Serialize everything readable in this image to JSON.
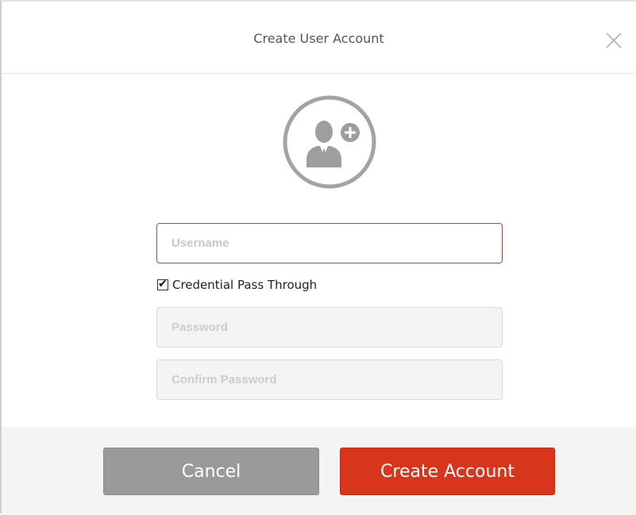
{
  "dialog": {
    "title": "Create User Account",
    "close_icon": "close-icon",
    "avatar_icon": "add-user-icon"
  },
  "form": {
    "username": {
      "value": "",
      "placeholder": "Username"
    },
    "credential_pass_through": {
      "label": "Credential Pass Through",
      "checked": true
    },
    "password": {
      "value": "",
      "placeholder": "Password"
    },
    "confirm_password": {
      "value": "",
      "placeholder": "Confirm Password"
    }
  },
  "actions": {
    "cancel_label": "Cancel",
    "create_label": "Create Account"
  },
  "colors": {
    "primary": "#d7351c",
    "secondary": "#9a9a9a",
    "username_border": "#a54a4a",
    "icon_gray": "#9e9e9e"
  }
}
